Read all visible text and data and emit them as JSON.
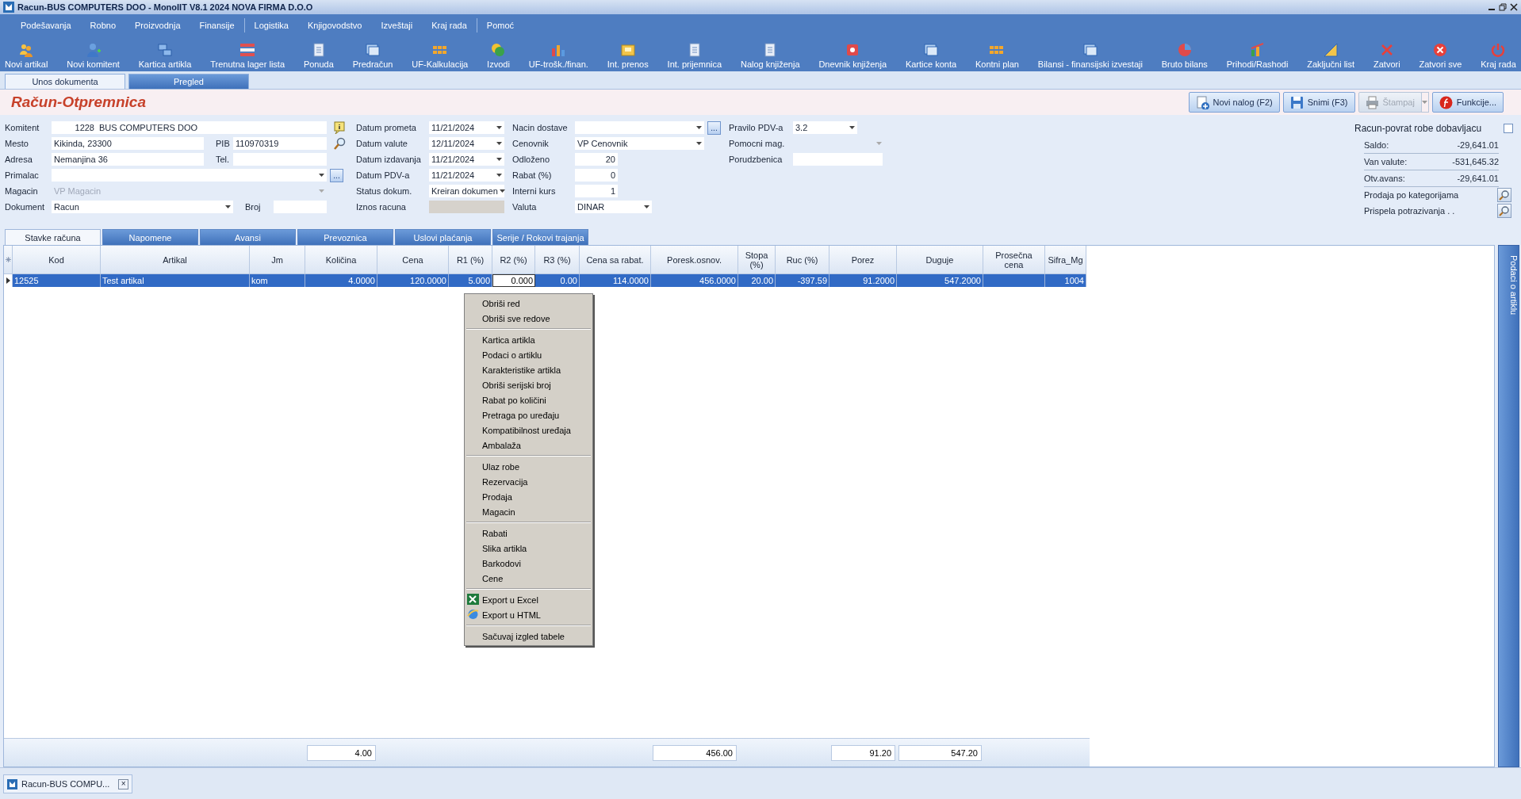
{
  "window": {
    "title": "Racun-BUS COMPUTERS DOO - MonoIIT V8.1 2024 NOVA FIRMA D.O.O"
  },
  "menu_groups": [
    {
      "items": [
        "Podešavanja",
        "Robno",
        "Proizvodnja",
        "Finansije"
      ]
    },
    {
      "items": [
        "Logistika",
        "Knjigovodstvo",
        "Izveštaji",
        "Kraj rada"
      ]
    },
    {
      "items": [
        "Pomoć"
      ]
    }
  ],
  "toolbar": [
    "Novi artikal",
    "Novi komitent",
    "Kartica artikla",
    "Trenutna lager lista",
    "Ponuda",
    "Predračun",
    "UF-Kalkulacija",
    "Izvodi",
    "UF-trošk./finan.",
    "Int. prenos",
    "Int. prijemnica",
    "Nalog knjiženja",
    "Dnevnik knjiženja",
    "Kartice konta",
    "Kontni plan",
    "Bilansi - finansijski izvestaji",
    "Bruto bilans",
    "Prihodi/Rashodi",
    "Zaključni list",
    "Zatvori",
    "Zatvori sve",
    "Kraj rada"
  ],
  "view_tabs": [
    {
      "label": "Unos dokumenta",
      "selected": true
    },
    {
      "label": "Pregled",
      "selected": false
    }
  ],
  "document": {
    "title": "Račun-Otpremnica"
  },
  "actions": [
    {
      "label": "Novi nalog (F2)",
      "disabled": false,
      "dropdown": false
    },
    {
      "label": "Snimi (F3)",
      "disabled": false,
      "dropdown": false
    },
    {
      "label": "Štampaj",
      "disabled": true,
      "dropdown": true
    },
    {
      "label": "Funkcije...",
      "disabled": false,
      "dropdown": false
    }
  ],
  "form": {
    "column_1": [
      {
        "label": "Komitent",
        "kind": "text",
        "code": "1228",
        "value": "BUS COMPUTERS DOO",
        "disabled": false
      },
      {
        "label": "Mesto",
        "kind": "text",
        "value": "Kikinda, 23300",
        "side_label": "PIB",
        "side_value": "110970319",
        "disabled": false
      },
      {
        "label": "Adresa",
        "kind": "text",
        "value": "Nemanjina 36",
        "side_label": "Tel.",
        "disabled": false
      },
      {
        "label": "Primalac",
        "kind": "dropdown",
        "button": "...",
        "disabled": false
      },
      {
        "label": "Magacin",
        "kind": "dropdown",
        "value": "VP Magacin",
        "disabled": true
      },
      {
        "label": "Dokument",
        "kind": "dropdown",
        "value": "Racun",
        "side_label": "Broj",
        "disabled": false
      }
    ],
    "column_2": [
      {
        "label": "Datum prometa",
        "kind": "dropdown",
        "value": "11/21/2024",
        "disabled": false
      },
      {
        "label": "Datum valute",
        "kind": "dropdown",
        "value": "12/11/2024",
        "disabled": false
      },
      {
        "label": "Datum izdavanja",
        "kind": "dropdown",
        "value": "11/21/2024",
        "disabled": false
      },
      {
        "label": "Datum PDV-a",
        "kind": "dropdown",
        "value": "11/21/2024",
        "disabled": false
      },
      {
        "label": "Status dokum.",
        "kind": "dropdown",
        "value": "Kreiran dokumen",
        "disabled": false
      },
      {
        "label": "Iznos racuna",
        "kind": "readonly",
        "disabled": false
      }
    ],
    "column_3": [
      {
        "label": "Nacin dostave",
        "kind": "dropdown",
        "button": "...",
        "disabled": false
      },
      {
        "label": "Cenovnik",
        "kind": "dropdown",
        "value": "VP Cenovnik",
        "disabled": false
      },
      {
        "label": "Odloženo",
        "kind": "number",
        "value": "20",
        "disabled": false
      },
      {
        "label": "Rabat (%)",
        "kind": "number",
        "value": "0",
        "disabled": false
      },
      {
        "label": "Interni kurs",
        "kind": "number",
        "value": "1",
        "disabled": false
      },
      {
        "label": "Valuta",
        "kind": "dropdown",
        "value": "DINAR",
        "disabled": false
      }
    ],
    "column_4": [
      {
        "label": "Pravilo PDV-a",
        "kind": "dropdown",
        "value": "3.2",
        "disabled": false
      },
      {
        "label": "Pomocni mag.",
        "kind": "dropdown",
        "disabled": true
      },
      {
        "label": "Porudzbenica",
        "kind": "text",
        "disabled": false
      }
    ]
  },
  "summary": {
    "title": "Racun-povrat robe dobavljacu",
    "checked": false,
    "balances": [
      {
        "label": "Saldo:",
        "value": "-29,641.01"
      },
      {
        "label": "Van valute:",
        "value": "-531,645.32"
      },
      {
        "label": "Otv.avans:",
        "value": "-29,641.01"
      }
    ],
    "links": [
      "Prodaja po kategorijama",
      "Prispela potrazivanja . ."
    ]
  },
  "sub_tabs": [
    {
      "label": "Stavke računa",
      "selected": true
    },
    {
      "label": "Napomene",
      "selected": false
    },
    {
      "label": "Avansi",
      "selected": false
    },
    {
      "label": "Prevoznica",
      "selected": false
    },
    {
      "label": "Uslovi plaćanja",
      "selected": false
    },
    {
      "label": "Serije / Rokovi trajanja",
      "selected": false
    }
  ],
  "table": {
    "columns": [
      "Kod",
      "Artikal",
      "Jm",
      "Količina",
      "Cena",
      "R1 (%)",
      "R2 (%)",
      "R3 (%)",
      "Cena sa rabat.",
      "Poresk.osnov.",
      "Stopa (%)",
      "Ruc (%)",
      "Porez",
      "Duguje",
      "Prosečna cena",
      "Sifra_Mg"
    ],
    "rows": [
      {
        "selected": true,
        "cells": [
          {
            "text": "12525",
            "editing": false
          },
          {
            "text": "Test artikal",
            "editing": false
          },
          {
            "text": "kom",
            "editing": false
          },
          {
            "text": "4.0000",
            "editing": false
          },
          {
            "text": "120.0000",
            "editing": false
          },
          {
            "text": "5.000",
            "editing": false
          },
          {
            "text": "0.000",
            "editing": true
          },
          {
            "text": "0.00",
            "editing": false
          },
          {
            "text": "114.0000",
            "editing": false
          },
          {
            "text": "456.0000",
            "editing": false
          },
          {
            "text": "20.00",
            "editing": false
          },
          {
            "text": "-397.59",
            "editing": false
          },
          {
            "text": "91.2000",
            "editing": false
          },
          {
            "text": "547.2000",
            "editing": false
          },
          {
            "editing": false
          },
          {
            "text": "1004",
            "editing": false
          }
        ]
      }
    ],
    "totals": [
      {
        "kind": "none"
      },
      {
        "kind": "none"
      },
      {
        "kind": "none"
      },
      {
        "kind": "sum",
        "value": "4.00"
      },
      {
        "kind": "none"
      },
      {
        "kind": "none"
      },
      {
        "kind": "none"
      },
      {
        "kind": "none"
      },
      {
        "kind": "none"
      },
      {
        "kind": "sum",
        "value": "456.00"
      },
      {
        "kind": "none"
      },
      {
        "kind": "none"
      },
      {
        "kind": "sum",
        "value": "91.20"
      },
      {
        "kind": "sum",
        "value": "547.20"
      },
      {
        "kind": "none"
      },
      {
        "kind": "none"
      }
    ]
  },
  "side_tab": {
    "label": "Podaci o artiklu"
  },
  "context_menu": [
    [
      "Obriši red",
      "Obriši sve redove"
    ],
    [
      "Kartica artikla",
      "Podaci o artiklu",
      "Karakteristike artikla",
      "Obriši serijski broj",
      "Rabat po količini",
      "Pretraga po uređaju",
      "Kompatibilnost uređaja",
      "Ambalaža"
    ],
    [
      "Ulaz robe",
      "Rezervacija",
      "Prodaja",
      "Magacin"
    ],
    [
      "Rabati",
      "Slika artikla",
      "Barkodovi",
      "Cene"
    ],
    [
      "Export u Excel",
      "Export u HTML"
    ],
    [
      "Sačuvaj izgled tabele"
    ]
  ],
  "taskbar": [
    {
      "label": "Racun-BUS COMPU...",
      "close": "×"
    }
  ]
}
